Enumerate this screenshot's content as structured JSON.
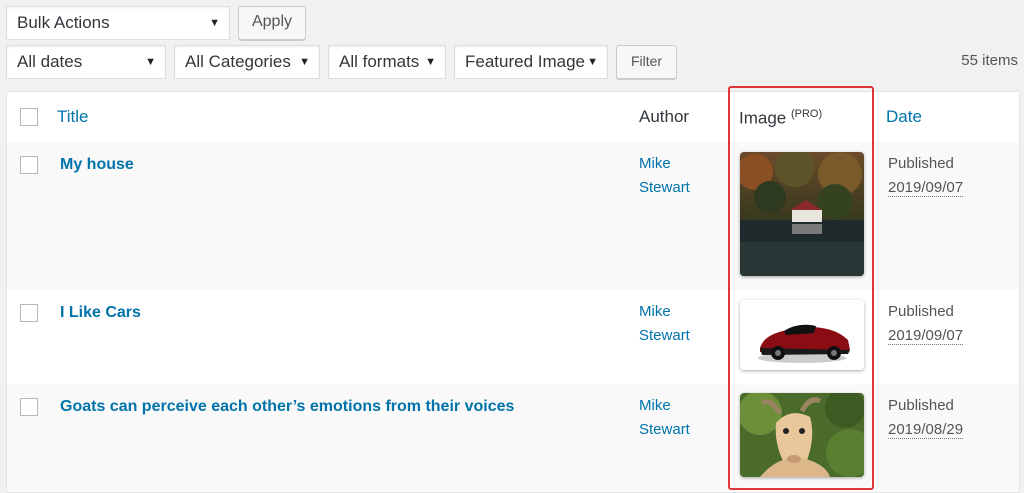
{
  "toolbar": {
    "bulk_actions": "Bulk Actions",
    "apply": "Apply",
    "filters": {
      "dates": "All dates",
      "categories": "All Categories",
      "formats": "All formats",
      "featured_image": "Featured Image"
    },
    "filter_button": "Filter",
    "items_count": "55 items"
  },
  "table": {
    "headers": {
      "title": "Title",
      "author": "Author",
      "image": "Image",
      "image_badge": "(PRO)",
      "date": "Date"
    },
    "rows": [
      {
        "title": "My house",
        "author_first": "Mike",
        "author_last": "Stewart",
        "status": "Published",
        "date": "2019/09/07",
        "image": "lake-house-thumbnail"
      },
      {
        "title": "I Like Cars",
        "author_first": "Mike",
        "author_last": "Stewart",
        "status": "Published",
        "date": "2019/09/07",
        "image": "red-sports-car-thumbnail"
      },
      {
        "title": "Goats can perceive each other’s emotions from their voices",
        "author_first": "Mike",
        "author_last": "Stewart",
        "status": "Published",
        "date": "2019/08/29",
        "image": "goat-thumbnail"
      }
    ]
  },
  "colors": {
    "link": "#0073aa",
    "highlight": "#e0353b"
  }
}
